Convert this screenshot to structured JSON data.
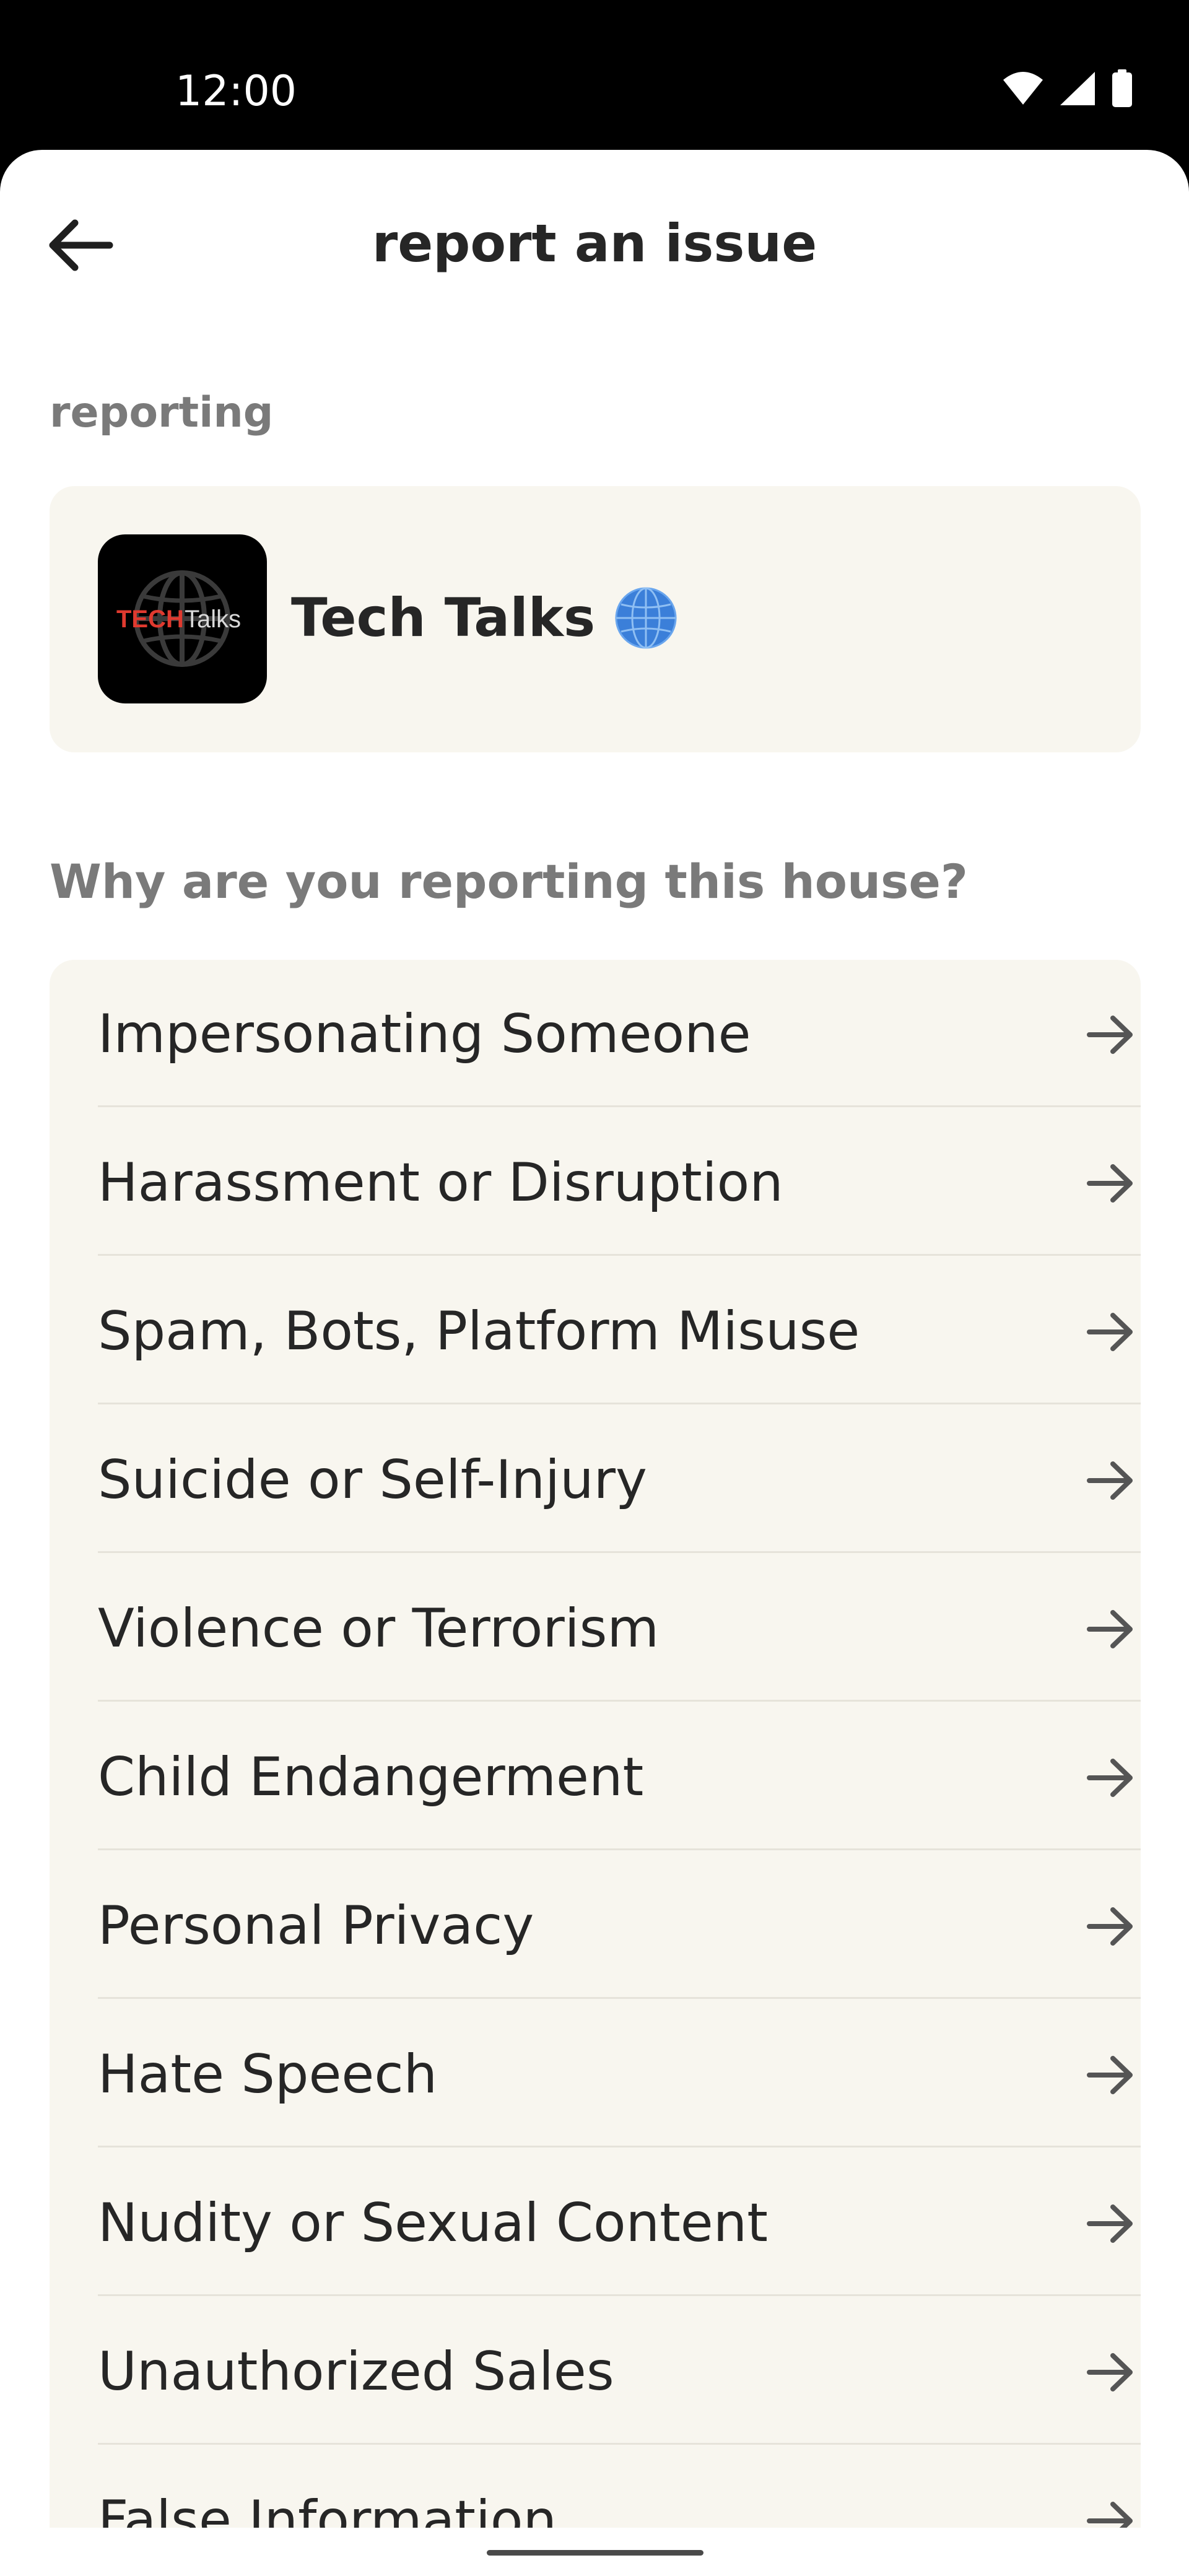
{
  "status_bar": {
    "time": "12:00"
  },
  "header": {
    "title": "report an issue",
    "back_icon": "arrow-left-icon"
  },
  "reporting_section": {
    "label": "reporting",
    "house": {
      "name": "Tech Talks",
      "logo_text_primary": "TECH",
      "logo_text_secondary": "Talks",
      "badge_icon": "globe-icon"
    }
  },
  "reasons_section": {
    "question": "Why are you reporting this house?",
    "items": [
      {
        "label": "Impersonating Someone"
      },
      {
        "label": "Harassment or Disruption"
      },
      {
        "label": "Spam, Bots, Platform Misuse"
      },
      {
        "label": "Suicide or Self-Injury"
      },
      {
        "label": "Violence or Terrorism"
      },
      {
        "label": "Child Endangerment"
      },
      {
        "label": "Personal Privacy"
      },
      {
        "label": "Hate Speech"
      },
      {
        "label": "Nudity or Sexual Content"
      },
      {
        "label": "Unauthorized Sales"
      },
      {
        "label": "False Information"
      }
    ]
  },
  "colors": {
    "card_background": "#f8f6ef",
    "logo_red": "#e03a2f",
    "globe_blue": "#3b7fd9"
  }
}
